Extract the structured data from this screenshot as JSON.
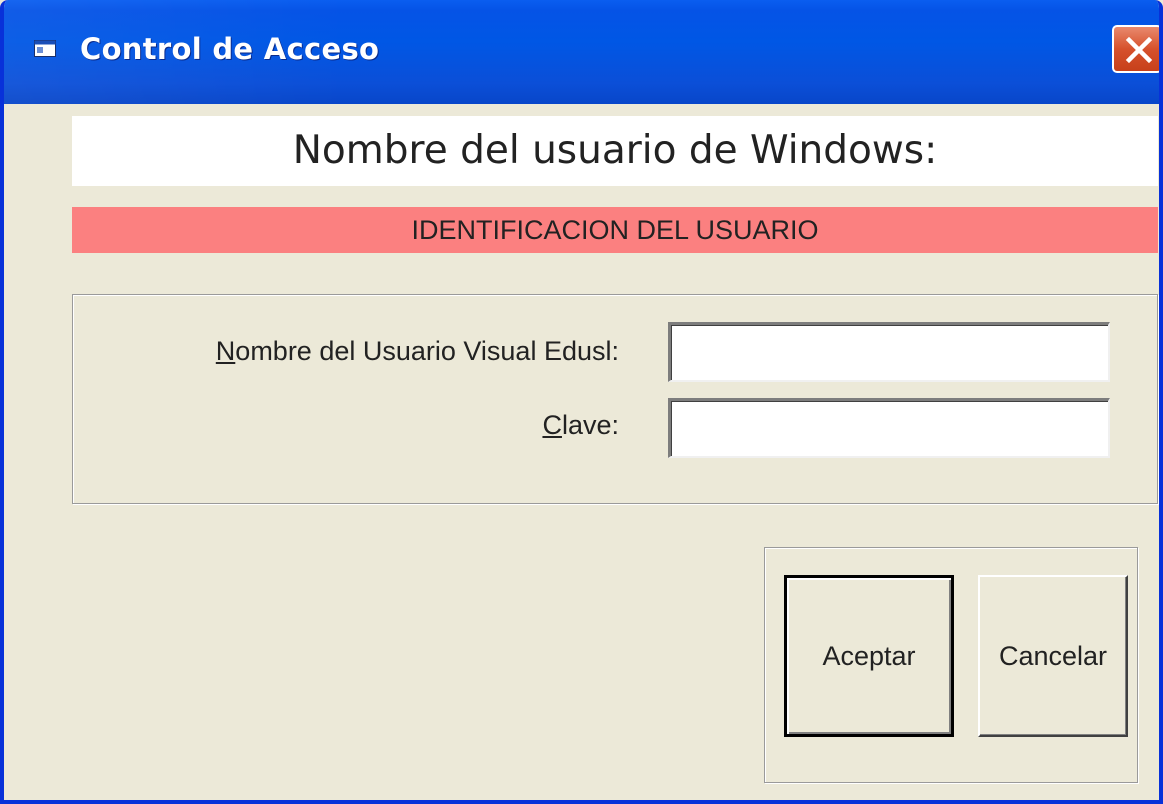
{
  "window": {
    "title": "Control de Acceso",
    "title_icon": "app-window-icon",
    "close_icon": "close-icon"
  },
  "header": {
    "windows_user_label": "Nombre del usuario de Windows:",
    "banner": "IDENTIFICACION DEL USUARIO",
    "banner_color": "#fb8080"
  },
  "form": {
    "user_label_mnemonic": "N",
    "user_label_rest": "ombre del Usuario Visual Edusl:",
    "user_value": "",
    "password_label_mnemonic": "C",
    "password_label_rest": "lave:",
    "password_value": ""
  },
  "buttons": {
    "accept": "Aceptar",
    "cancel": "Cancelar"
  },
  "colors": {
    "titlebar": "#0057e5",
    "window_bg": "#ece9d8",
    "close": "#d6512c"
  }
}
